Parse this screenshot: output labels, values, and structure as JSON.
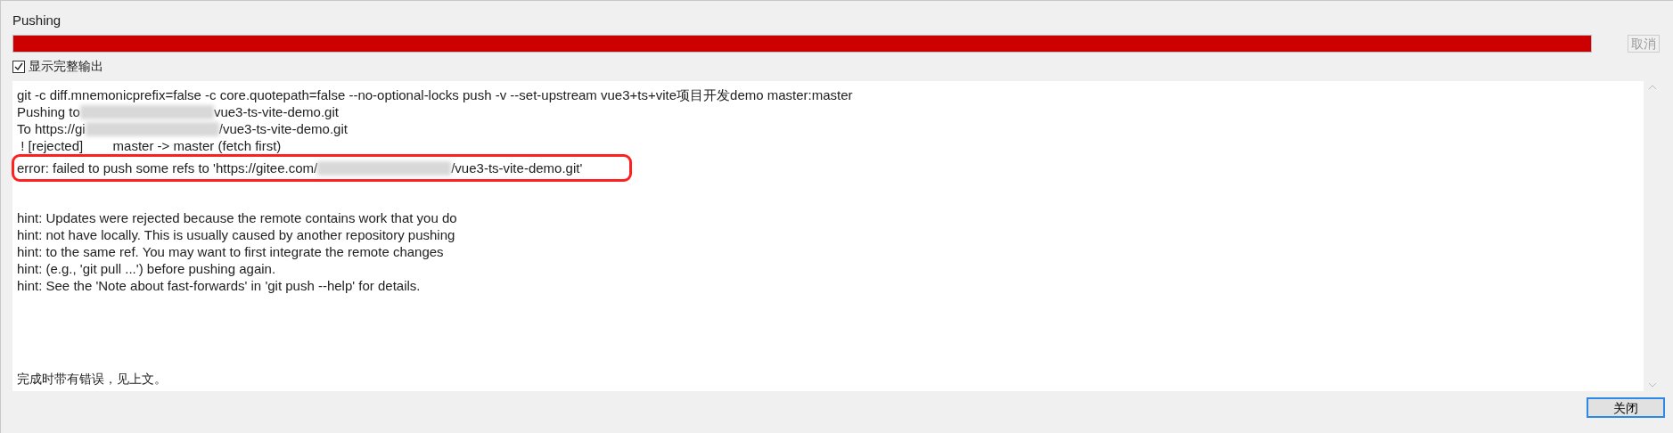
{
  "title": "Pushing",
  "progress": {
    "level": 1
  },
  "cancel_button": {
    "label": "取消",
    "disabled": true
  },
  "show_full_output": {
    "label": "显示完整输出",
    "checked": true
  },
  "output": {
    "lines": [
      {
        "parts": [
          "git -c diff.mnemonicprefix=false -c core.quotepath=false --no-optional-locks push -v --set-upstream vue3+ts+vite项目开发demo master:master"
        ],
        "highlighted": false
      },
      {
        "parts": [
          "Pushing to",
          "vue3-ts-vite-demo.git"
        ],
        "highlighted": false
      },
      {
        "parts": [
          "To https://gi",
          "/vue3-ts-vite-demo.git"
        ],
        "highlighted": false
      },
      {
        "parts": [
          " ! [rejected]        master -> master (fetch first)"
        ],
        "highlighted": false
      },
      {
        "parts": [
          "error: failed to push some refs to 'https://gitee.com/",
          "/vue3-ts-vite-demo.git'"
        ],
        "highlighted": true
      }
    ],
    "hints": [
      "hint: Updates were rejected because the remote contains work that you do",
      "hint: not have locally. This is usually caused by another repository pushing",
      "hint: to the same ref. You may want to first integrate the remote changes",
      "hint: (e.g., 'git pull ...') before pushing again.",
      "hint: See the 'Note about fast-forwards' in 'git push --help' for details."
    ],
    "summary": "完成时带有错误，见上文。"
  },
  "close_button": {
    "label": "关闭",
    "focused": true
  }
}
